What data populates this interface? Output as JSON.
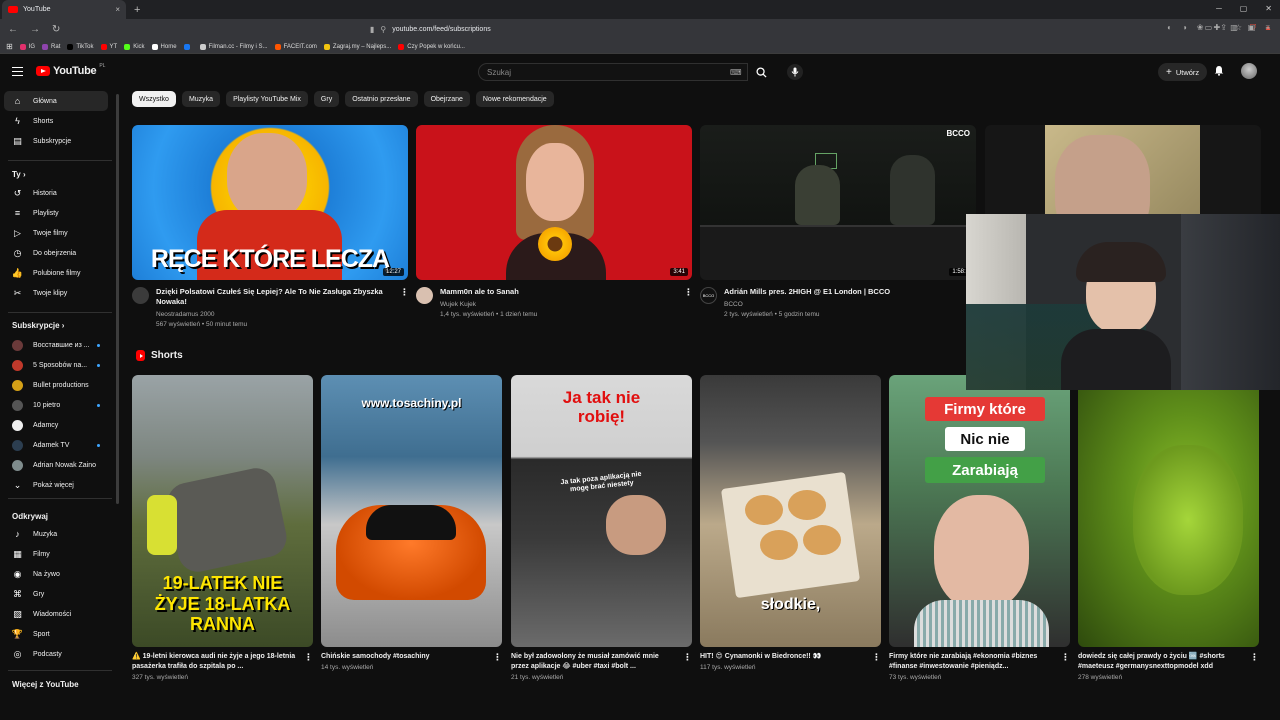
{
  "browser": {
    "tab_title": "YouTube",
    "tab_close": "×",
    "new_tab": "+",
    "url": "youtube.com/feed/subscriptions",
    "bookmarks": [
      {
        "label": "IG",
        "color": "#e1306c"
      },
      {
        "label": "Rat",
        "color": "#8e44ad"
      },
      {
        "label": "TikTok",
        "color": "#000000"
      },
      {
        "label": "YT",
        "color": "#ff0000"
      },
      {
        "label": "Kick",
        "color": "#53fc18"
      },
      {
        "label": "Home",
        "color": "#ffffff"
      },
      {
        "label": "",
        "color": "#1877f2"
      },
      {
        "label": "Filman.cc - Filmy i S...",
        "color": "#cccccc"
      },
      {
        "label": "FACEIT.com",
        "color": "#ff5500"
      },
      {
        "label": "Zagraj.my – Najleps...",
        "color": "#f1c40f"
      },
      {
        "label": "Czy Popek w końcu...",
        "color": "#ff0000"
      }
    ]
  },
  "masthead": {
    "logo_text": "YouTube",
    "logo_country": "PL",
    "search_placeholder": "Szukaj",
    "create_label": "Utwórz"
  },
  "sidebar": {
    "main": [
      {
        "label": "Główna",
        "icon": "home-icon"
      },
      {
        "label": "Shorts",
        "icon": "shorts-icon"
      },
      {
        "label": "Subskrypcje",
        "icon": "subscriptions-icon"
      }
    ],
    "you_header": "Ty",
    "you": [
      {
        "label": "Historia",
        "icon": "history-icon"
      },
      {
        "label": "Playlisty",
        "icon": "playlist-icon"
      },
      {
        "label": "Twoje filmy",
        "icon": "your-videos-icon"
      },
      {
        "label": "Do obejrzenia",
        "icon": "watch-later-icon"
      },
      {
        "label": "Polubione filmy",
        "icon": "like-icon"
      },
      {
        "label": "Twoje klipy",
        "icon": "clips-icon"
      }
    ],
    "subs_header": "Subskrypcje",
    "subs": [
      {
        "label": "Восставшие из ...",
        "color": "#6a3a3a"
      },
      {
        "label": "5 Sposobów na...",
        "color": "#c0392b"
      },
      {
        "label": "Bullet productions",
        "color": "#d4a017"
      },
      {
        "label": "10 pietro",
        "color": "#555555"
      },
      {
        "label": "Adamcy",
        "color": "#eeeeee"
      },
      {
        "label": "Adamek TV",
        "color": "#2c3e50"
      },
      {
        "label": "Adrian Nowak Zaino",
        "color": "#7f8c8d"
      }
    ],
    "show_more": "Pokaż więcej",
    "explore_header": "Odkrywaj",
    "explore": [
      {
        "label": "Muzyka",
        "icon": "music-icon"
      },
      {
        "label": "Filmy",
        "icon": "movies-icon"
      },
      {
        "label": "Na żywo",
        "icon": "live-icon"
      },
      {
        "label": "Gry",
        "icon": "gaming-icon"
      },
      {
        "label": "Wiadomości",
        "icon": "news-icon"
      },
      {
        "label": "Sport",
        "icon": "sport-icon"
      },
      {
        "label": "Podcasty",
        "icon": "podcast-icon"
      }
    ],
    "more_header": "Więcej z YouTube"
  },
  "chips": [
    "Wszystko",
    "Muzyka",
    "Playlisty YouTube Mix",
    "Gry",
    "Ostatnio przesłane",
    "Obejrzane",
    "Nowe rekomendacje"
  ],
  "videos": [
    {
      "title": "Dzięki Polsatowi Czułeś Się Lepiej? Ale To Nie Zasługa Zbyszka Nowaka!",
      "channel": "Neostradamus 2000",
      "stats": "567 wyświetleń • 50 minut temu",
      "duration": "12:27",
      "overlay": "RĘCE KTÓRE LECZĄ"
    },
    {
      "title": "Mamm0n ale to Sanah",
      "channel": "Wujek Kujek",
      "stats": "1,4 tys. wyświetleń • 1 dzień temu",
      "duration": "3:41"
    },
    {
      "title": "Adrián Mills pres. 2HIGH @ E1 London | BCCO",
      "channel": "BCCO",
      "stats": "2 tys. wyświetleń • 5 godzin temu",
      "duration": "1:58:3",
      "badge": "BCCO"
    },
    {
      "title": "",
      "channel": "",
      "stats": ""
    }
  ],
  "shorts_header": "Shorts",
  "shorts": [
    {
      "title": "⚠️ 19-letni kierowca audi nie żyje a jego 18-letnia pasażerka trafiła do szpitala po ...",
      "views": "327 tys. wyświetleń",
      "overlay": "19-LATEK NIE ŻYJE 18-LATKA RANNA"
    },
    {
      "title": "Chińskie samochody #tosachiny",
      "views": "14 tys. wyświetleń",
      "overlay": "www.tosachiny.pl"
    },
    {
      "title": "Nie był zadowolony że musiał zamówić mnie przez aplikacje 😂 #uber #taxi #bolt ...",
      "views": "21 tys. wyświetleń",
      "overlay": "Ja tak nie robię!",
      "sub_overlay": "Ja tak poza aplikacją nie mogę brać niestety"
    },
    {
      "title": "HIT! 😍 Cynamonki w Biedronce!! 👀",
      "views": "117 tys. wyświetleń",
      "overlay": "słodkie,"
    },
    {
      "title": "Firmy które nie zarabiają #ekonomia #biznes #finanse #inwestowanie #pieniądz...",
      "views": "73 tys. wyświetleń",
      "overlay_1": "Firmy które",
      "overlay_2": "Nic nie",
      "overlay_3": "Zarabiają"
    },
    {
      "title": "dowiedz się całej prawdy o życiu 🆒 #shorts #maeteusz #germanysnexttopmodel xdd",
      "views": "278 wyświetleń"
    }
  ]
}
